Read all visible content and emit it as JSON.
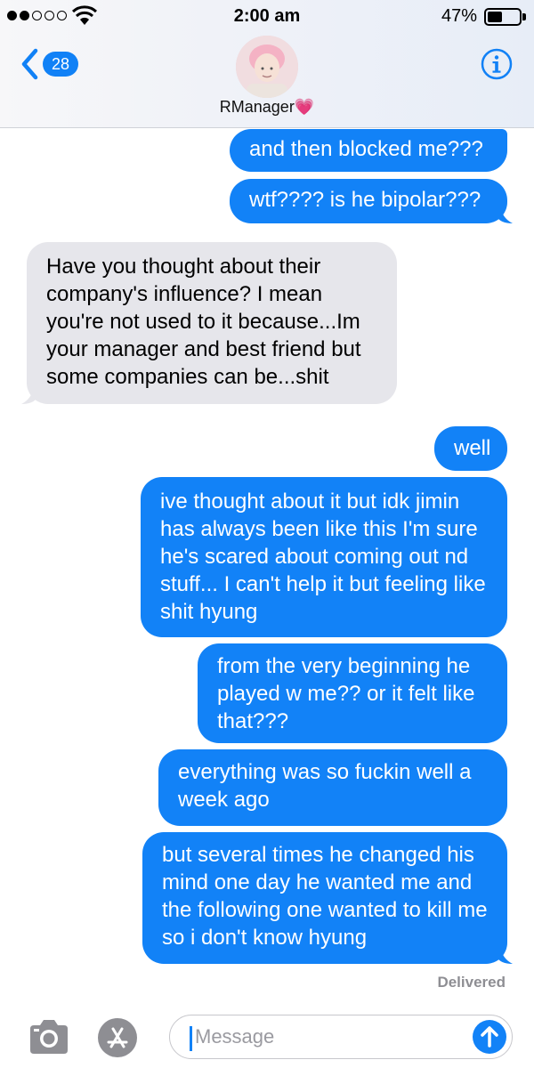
{
  "status_bar": {
    "time": "2:00 am",
    "battery_percent": "47%",
    "battery_level": 0.47,
    "signal_bars_filled": 2,
    "signal_bars_total": 5
  },
  "header": {
    "back_count": "28",
    "contact_name": "RManager",
    "contact_emoji": "💗",
    "info_icon": "info-icon",
    "back_icon": "chevron-left-icon"
  },
  "messages": [
    {
      "direction": "out",
      "text": "and then blocked me???"
    },
    {
      "direction": "out",
      "text": "wtf???? is he bipolar???"
    },
    {
      "direction": "in",
      "text": "Have you thought about their company's influence? I mean you're not used to it because...Im your manager and best friend but some companies can be...shit"
    },
    {
      "direction": "out",
      "text": "well"
    },
    {
      "direction": "out",
      "text": "ive thought about it but idk jimin has always been like this I'm sure he's scared about coming out nd stuff... I can't help it but feeling like shit hyung"
    },
    {
      "direction": "out",
      "text": "from the very beginning he played w me?? or it felt like that???"
    },
    {
      "direction": "out",
      "text": "everything was so fuckin well a week ago"
    },
    {
      "direction": "out",
      "text": "but several times he changed his mind one day he wanted me and the following one wanted to kill me so i don't know hyung"
    }
  ],
  "delivery_status": "Delivered",
  "composer": {
    "placeholder": "Message",
    "camera_icon": "camera-icon",
    "apps_icon": "app-store-icon",
    "send_icon": "send-arrow-icon"
  },
  "colors": {
    "outgoing_bubble": "#1282f7",
    "incoming_bubble": "#e6e6eb",
    "accent": "#1181f6"
  }
}
